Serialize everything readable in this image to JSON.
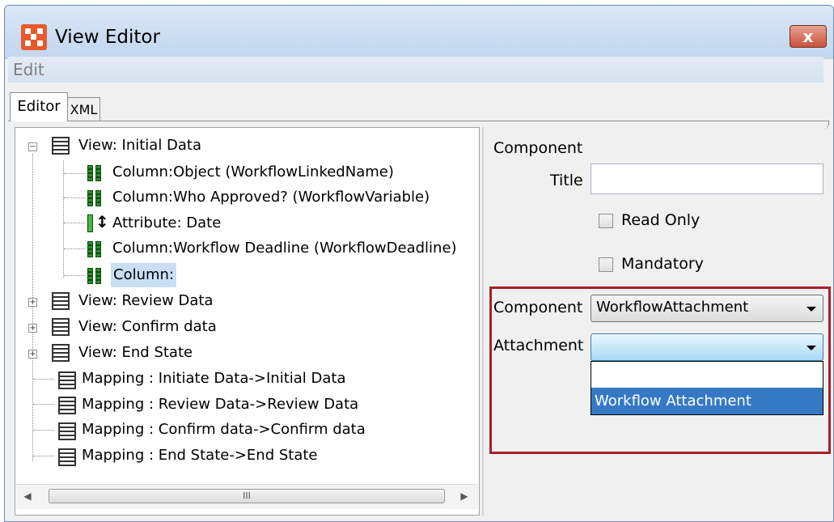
{
  "window": {
    "title": "View Editor",
    "close_label": "x"
  },
  "menu": {
    "edit": "Edit"
  },
  "tabs": {
    "editor": "Editor",
    "xml": "XML"
  },
  "tree": {
    "view_initial": "View: Initial Data",
    "col_object": "Column:Object (WorkflowLinkedName)",
    "col_who": "Column:Who Approved? (WorkflowVariable)",
    "attr_date": "Attribute: Date",
    "col_deadline": "Column:Workflow Deadline (WorkflowDeadline)",
    "col_empty": "Column:",
    "view_review": "View: Review Data",
    "view_confirm": "View: Confirm data",
    "view_end": "View: End State",
    "map_initiate": "Mapping : Initiate Data->Initial Data",
    "map_review": "Mapping : Review Data->Review Data",
    "map_confirm": "Mapping : Confirm data->Confirm data",
    "map_end": "Mapping : End State->End State",
    "expand_minus": "−",
    "expand_plus": "+"
  },
  "scrollbar": {
    "left": "◀",
    "right": "▶",
    "grip": "III"
  },
  "props": {
    "section_label": "Component",
    "title_label": "Title",
    "title_value": "",
    "read_only": "Read Only",
    "mandatory": "Mandatory",
    "component_label": "Component",
    "component_value": "WorkflowAttachment",
    "attachment_label": "Attachment",
    "attachment_value": "",
    "attachment_options": [
      "",
      "Workflow Attachment"
    ]
  }
}
